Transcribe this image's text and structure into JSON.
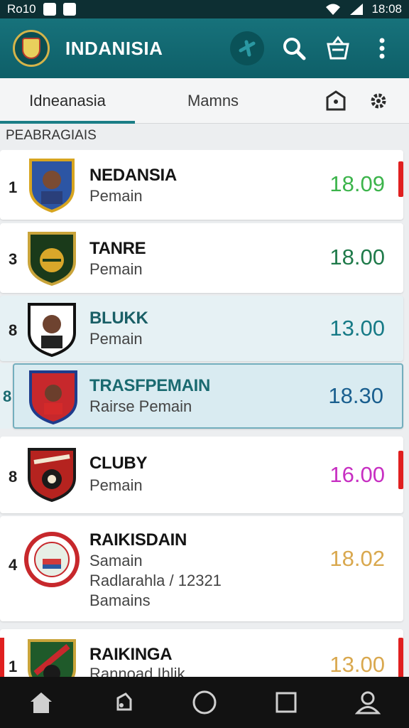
{
  "status": {
    "left_text": "Ro10",
    "time": "18:08"
  },
  "appbar": {
    "title": "INDANISIA"
  },
  "tabs": [
    {
      "label": "Idneanasia"
    },
    {
      "label": "Mamns"
    }
  ],
  "section_label": "PEABRAGIAIS",
  "rows": [
    {
      "rank": "1",
      "name": "NEDANSIA",
      "sub": "Pemain",
      "score": "18.09",
      "score_color": "#3cb44b"
    },
    {
      "rank": "3",
      "name": "TANRE",
      "sub": "Pemain",
      "score": "18.00",
      "score_color": "#1f7a4a"
    },
    {
      "rank": "8",
      "name": "BLUKK",
      "sub": "Pemain",
      "score": "13.00",
      "score_color": "#167a86"
    },
    {
      "rank": "8",
      "name": "TRASFPEMAIN",
      "sub": "Rairse Pemain",
      "score": "18.30",
      "score_color": "#1a5f8f"
    },
    {
      "rank": "8",
      "name": "CLUBY",
      "sub": "Pemain",
      "score": "16.00",
      "score_color": "#c72fc2"
    },
    {
      "rank": "4",
      "name": "RAIKISDAIN",
      "sub": "Samain",
      "extra1": "Radlarahla / 12321",
      "extra2": "Bamains",
      "score": "18.02",
      "score_color": "#d9a84e"
    },
    {
      "rank": "1",
      "name": "RAIKINGA",
      "sub": "Rannoad Ihlik",
      "score": "13.00",
      "score_color": "#d9a84e"
    }
  ],
  "icons": {
    "app_logo": "emblem-logo",
    "blob": "plus-icon",
    "search": "search-icon",
    "basket": "basket-icon",
    "more": "more-vert-icon",
    "tab_pentagon": "pentagon-icon",
    "settings": "gear-icon",
    "nav": [
      "home-icon",
      "back-icon",
      "circle-icon",
      "square-icon",
      "profile-icon"
    ]
  },
  "colors": {
    "appbar": "#127079",
    "accent": "#1a7d86",
    "marker": "#e02020"
  }
}
